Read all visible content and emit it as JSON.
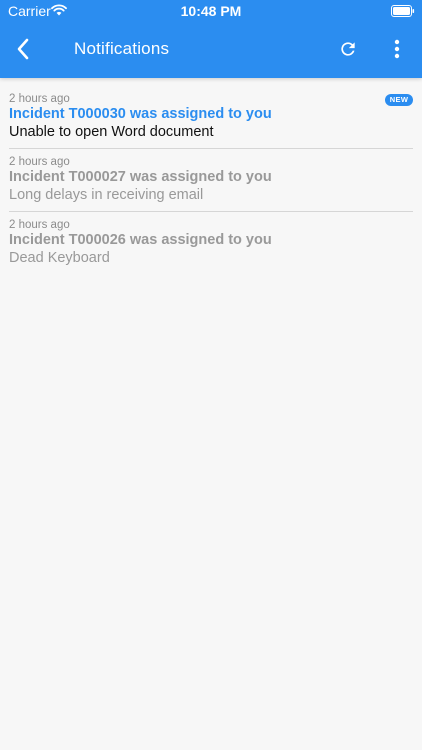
{
  "status_bar": {
    "carrier": "Carrier",
    "time": "10:48 PM"
  },
  "header": {
    "title": "Notifications",
    "background": "#2b8df0",
    "back_icon": "chevron-left-icon",
    "refresh_icon": "refresh-icon",
    "more_icon": "more-vertical-icon"
  },
  "notifications": [
    {
      "time": "2 hours ago",
      "title": "Incident T000030 was assigned to you",
      "description": "Unable to open Word document",
      "badge": "NEW",
      "unread": true
    },
    {
      "time": "2 hours ago",
      "title": "Incident T000027 was assigned to you",
      "description": "Long delays in receiving email",
      "unread": false
    },
    {
      "time": "2 hours ago",
      "title": "Incident T000026 was assigned to you",
      "description": "Dead Keyboard",
      "unread": false
    }
  ]
}
